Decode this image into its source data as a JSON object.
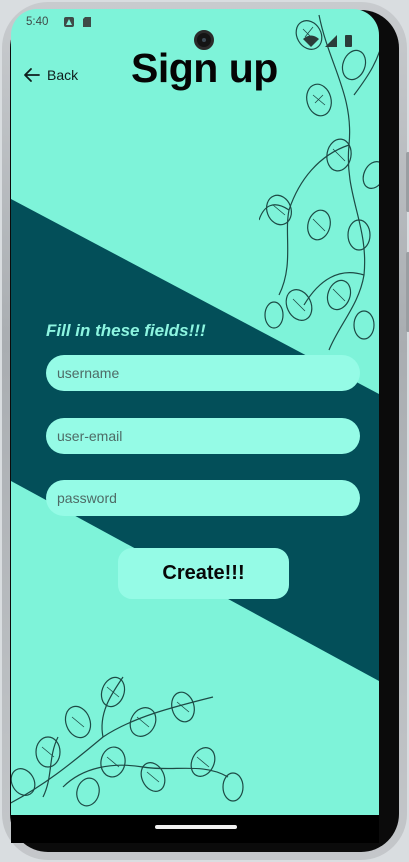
{
  "status_bar": {
    "time": "5:40"
  },
  "header": {
    "back_label": "Back",
    "title": "Sign up"
  },
  "form": {
    "instruction": "Fill in these fields!!!",
    "username_placeholder": "username",
    "email_placeholder": "user-email",
    "password_placeholder": "password",
    "submit_label": "Create!!!"
  },
  "colors": {
    "background": "#7ef3d9",
    "band": "#034f59",
    "field": "#95fbe6",
    "instruction": "#8df5e0"
  },
  "icons": [
    "back-arrow-icon",
    "camera-icon",
    "wifi-icon",
    "signal-icon",
    "battery-icon",
    "botanical-decoration"
  ]
}
